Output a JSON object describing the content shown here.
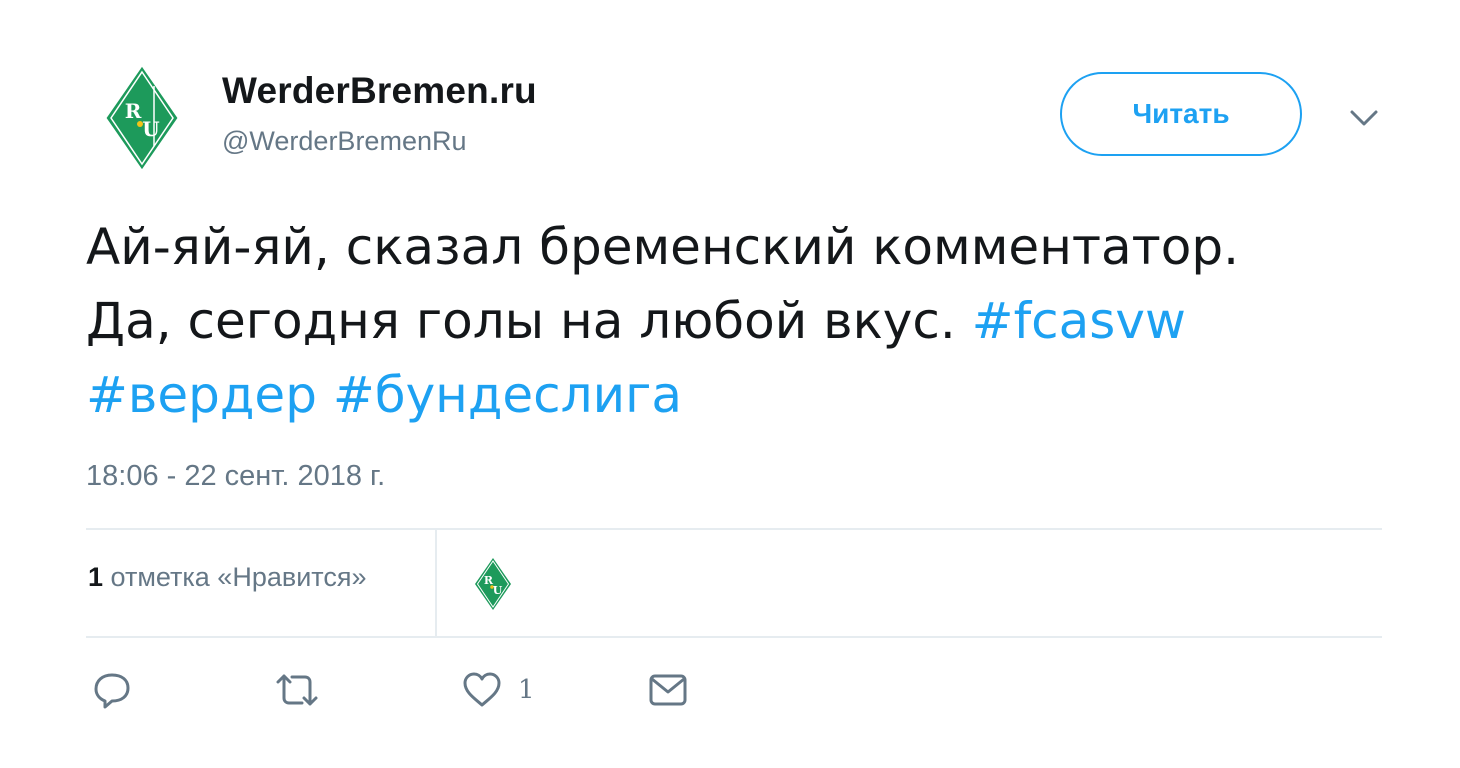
{
  "user": {
    "display_name": "WerderBremen.ru",
    "handle": "@WerderBremenRu",
    "avatar_icon": "werder-ru-diamond-logo-icon",
    "avatar_color": "#1d9a5b"
  },
  "follow_button": {
    "label": "Читать"
  },
  "menu_caret": {
    "icon": "chevron-down-icon"
  },
  "tweet": {
    "text_line1": "Ай-яй-яй, сказал бременский комментатор.",
    "text_line2": "Да, сегодня голы на любой вкус.",
    "hashtags": [
      "#fcasvw",
      "#вердер",
      "#бундеслига"
    ],
    "timestamp": "18:06 - 22 сент. 2018 г."
  },
  "stats": {
    "likes_count": "1",
    "likes_label": "отметка «Нравится»"
  },
  "actions": {
    "reply_icon": "reply-icon",
    "retweet_icon": "retweet-icon",
    "like_icon": "heart-icon",
    "like_count": "1",
    "dm_icon": "envelope-icon"
  },
  "colors": {
    "accent": "#1da1f2",
    "text": "#14171a",
    "secondary": "#657786",
    "divider": "#e6ecf0"
  }
}
